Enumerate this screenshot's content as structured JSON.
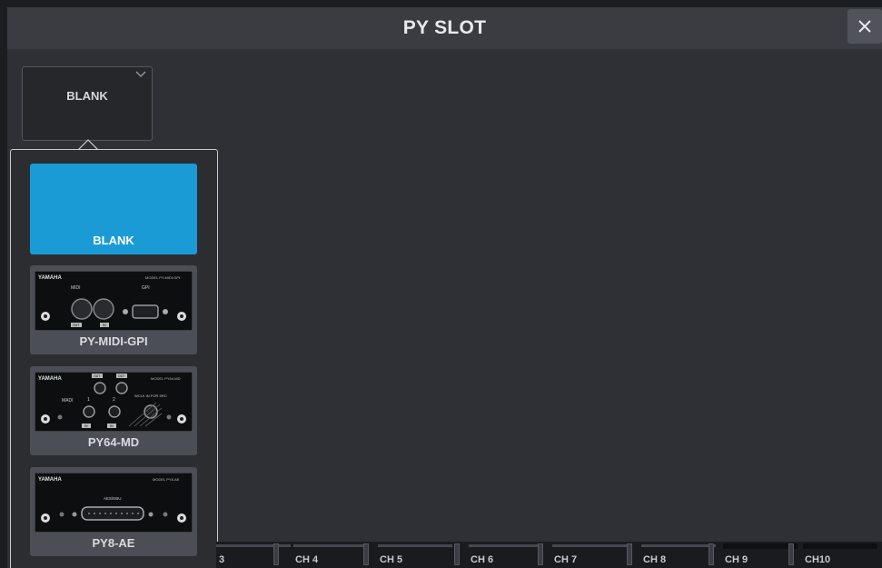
{
  "window": {
    "title": "PY SLOT",
    "close_label": "×"
  },
  "slot_select": {
    "value": "BLANK"
  },
  "options": [
    {
      "label": "BLANK",
      "selected": true
    },
    {
      "label": "PY-MIDI-GPI",
      "card_brand": "YAMAHA",
      "card_model": "MODEL PY-MIDI-GPI",
      "card_texts": [
        "MIDI",
        "GPI",
        "OUT",
        "IN"
      ]
    },
    {
      "label": "PY64-MD",
      "card_brand": "YAMAHA",
      "card_model": "MODEL PY64-MD",
      "card_texts": [
        "MADI",
        "OUT",
        "OUT",
        "1",
        "2",
        "IN",
        "IN",
        "WCLK IN FOR SRC"
      ]
    },
    {
      "label": "PY8-AE",
      "card_brand": "YAMAHA",
      "card_model": "MODEL PY8-AE",
      "card_texts": [
        "AES/EBU"
      ]
    }
  ],
  "channels": [
    "3",
    "CH 4",
    "CH 5",
    "CH 6",
    "CH 7",
    "CH 8",
    "CH 9",
    "CH10"
  ],
  "colors": {
    "accent": "#1a9bd6",
    "background": "#2e3035",
    "titlebar": "#3a3c41"
  }
}
